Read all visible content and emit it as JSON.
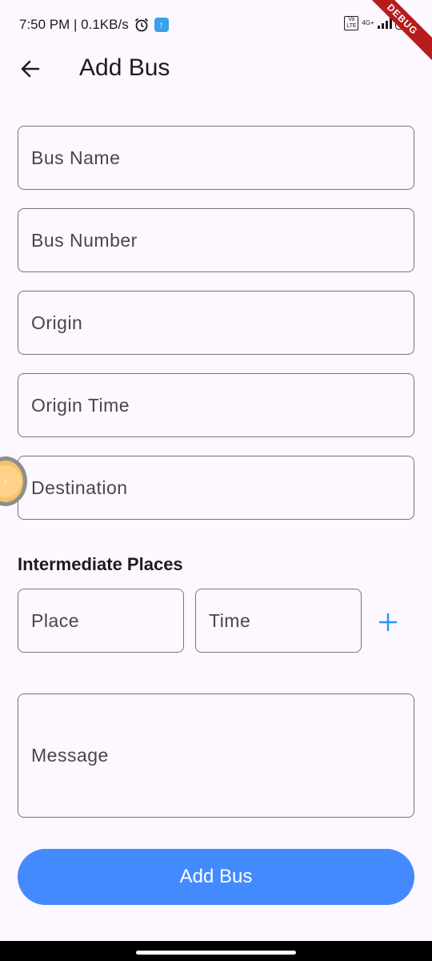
{
  "status_bar": {
    "time_speed": "7:50 PM | 0.1KB/s",
    "volte": "Vo LTE",
    "network": "4G+",
    "battery": "39"
  },
  "debug_banner": "DEBUG",
  "app_bar": {
    "title": "Add Bus",
    "back_icon": "arrow-left-icon"
  },
  "form": {
    "bus_name": {
      "placeholder": "Bus Name"
    },
    "bus_number": {
      "placeholder": "Bus Number"
    },
    "origin": {
      "placeholder": "Origin"
    },
    "origin_time": {
      "placeholder": "Origin Time"
    },
    "destination": {
      "placeholder": "Destination"
    },
    "intermediate": {
      "title": "Intermediate Places",
      "place_placeholder": "Place",
      "time_placeholder": "Time",
      "add_icon": "plus-icon"
    },
    "message": {
      "placeholder": "Message"
    },
    "submit_label": "Add Bus"
  },
  "colors": {
    "background": "#fdf7ff",
    "primary": "#448aff",
    "plus": "#2196f3",
    "outline": "#79747e"
  }
}
